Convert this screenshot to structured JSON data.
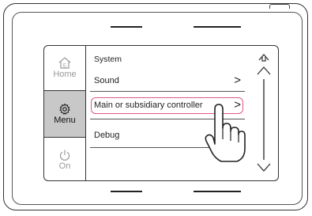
{
  "sidebar": {
    "home_label": "Home",
    "menu_label": "Menu",
    "on_label": "On"
  },
  "main": {
    "section_title": "System",
    "items": [
      {
        "label": "Sound",
        "chevron": ">"
      },
      {
        "label": "Main or subsidiary controller",
        "chevron": ">"
      },
      {
        "label": "Debug",
        "chevron": ""
      }
    ],
    "highlighted_index": 1
  },
  "icons": {
    "home": "home-icon",
    "menu": "gear-icon",
    "on": "power-icon",
    "back": "back-arrow-icon",
    "scroll_up": "chevron-up-icon",
    "scroll_down": "chevron-down-icon",
    "pointer": "hand-pointer-icon"
  },
  "colors": {
    "highlight": "#e0578a",
    "selected_bg": "#c8c8c8",
    "inactive_text": "#999999"
  }
}
